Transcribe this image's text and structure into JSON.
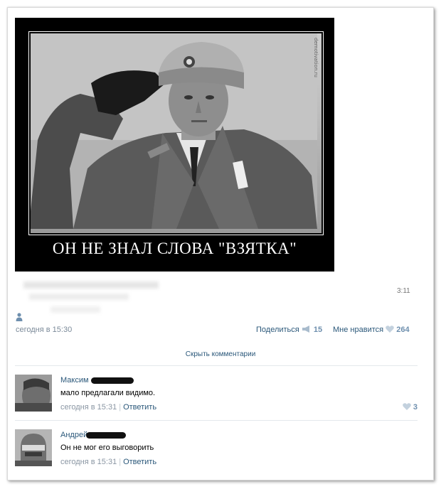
{
  "post": {
    "caption": "ОН НЕ ЗНАЛ СЛОВА \"ВЗЯТКА\"",
    "watermark": "demotivation.ru",
    "time_right": "3:11",
    "date": "сегодня в 15:30",
    "share_label": "Поделиться",
    "share_count": "15",
    "like_label": "Мне нравится",
    "like_count": "264",
    "hide_comments": "Скрыть комментарии"
  },
  "comments": [
    {
      "author": "Максим",
      "text": "мало предлагали видимо.",
      "time": "сегодня в 15:31",
      "reply": "Ответить",
      "likes": "3"
    },
    {
      "author": "Андрей",
      "text": "Он не мог его выговорить",
      "time": "сегодня в 15:31",
      "reply": "Ответить",
      "likes": ""
    }
  ],
  "colors": {
    "link": "#2b587a",
    "meta": "#7b8a99",
    "like": "#6e8fae"
  },
  "icons": [
    "person-icon",
    "megaphone-icon",
    "heart-icon"
  ]
}
